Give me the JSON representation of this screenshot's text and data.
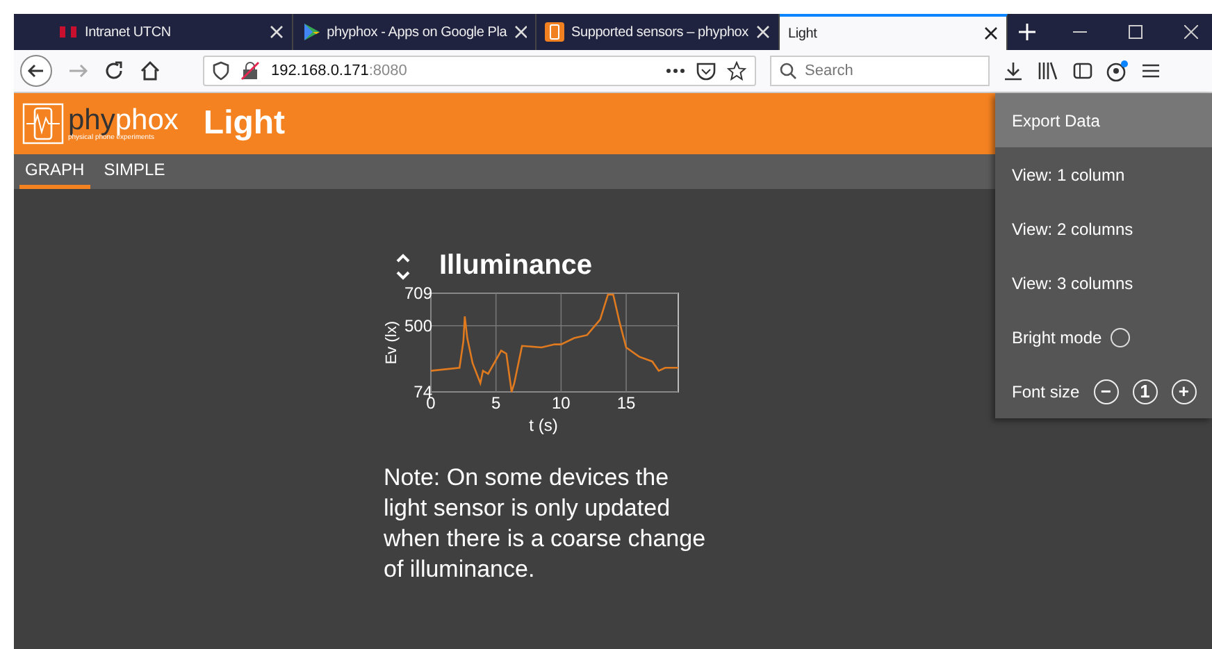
{
  "browser": {
    "tabs": [
      {
        "title": "Intranet UTCN",
        "kind": "utcn",
        "selected": false
      },
      {
        "title": "phyphox - Apps on Google Pla",
        "kind": "play",
        "selected": false
      },
      {
        "title": "Supported sensors – phyphox",
        "kind": "phyphox",
        "selected": false
      },
      {
        "title": "Light",
        "kind": "none",
        "selected": true
      }
    ],
    "address": {
      "host": "192.168.0.171",
      "port": ":8080"
    },
    "search": {
      "placeholder": "Search"
    }
  },
  "app": {
    "logo": {
      "name_dark": "phy",
      "name_light": "phox",
      "tagline": "physical phone experiments"
    },
    "title": "Light",
    "tabs": [
      {
        "label": "GRAPH",
        "selected": true
      },
      {
        "label": "SIMPLE",
        "selected": false
      }
    ]
  },
  "graph": {
    "title": "Illuminance",
    "chart_data": {
      "type": "line",
      "xlabel": "t (s)",
      "ylabel": "Ev (lx)",
      "x": [
        0,
        2.2,
        2.5,
        2.6,
        2.8,
        3.2,
        3.8,
        4.0,
        4.4,
        5.4,
        5.8,
        6.2,
        6.4,
        7,
        8.5,
        9.5,
        10,
        11,
        12,
        13,
        13.6,
        14,
        14.5,
        15,
        16,
        17,
        17.5,
        18,
        19
      ],
      "series": [
        {
          "color": "#e07a1f",
          "values": [
            210,
            230,
            400,
            560,
            420,
            260,
            130,
            210,
            190,
            340,
            320,
            74,
            130,
            370,
            360,
            380,
            380,
            420,
            440,
            540,
            700,
            700,
            520,
            360,
            300,
            270,
            210,
            230,
            230
          ]
        }
      ],
      "grid": true,
      "xlim": [
        0,
        19
      ],
      "ylim": [
        74,
        709
      ],
      "xticks": [
        0,
        5,
        10,
        15
      ],
      "yticks": [
        74,
        500,
        709
      ]
    }
  },
  "note": "Note: On some devices the light sensor is only updated when there is a coarse change of illuminance.",
  "menu": {
    "items": [
      {
        "label": "Export Data",
        "kind": "plain",
        "selected": true
      },
      {
        "label": "View: 1 column",
        "kind": "plain",
        "selected": false
      },
      {
        "label": "View: 2 columns",
        "kind": "plain",
        "selected": false
      },
      {
        "label": "View: 3 columns",
        "kind": "plain",
        "selected": false
      },
      {
        "label": "Bright mode",
        "kind": "toggle",
        "checked": false,
        "selected": false
      },
      {
        "label": "Font size",
        "kind": "fontsize",
        "value": "1",
        "minus": "−",
        "plus": "+",
        "selected": false
      }
    ]
  }
}
